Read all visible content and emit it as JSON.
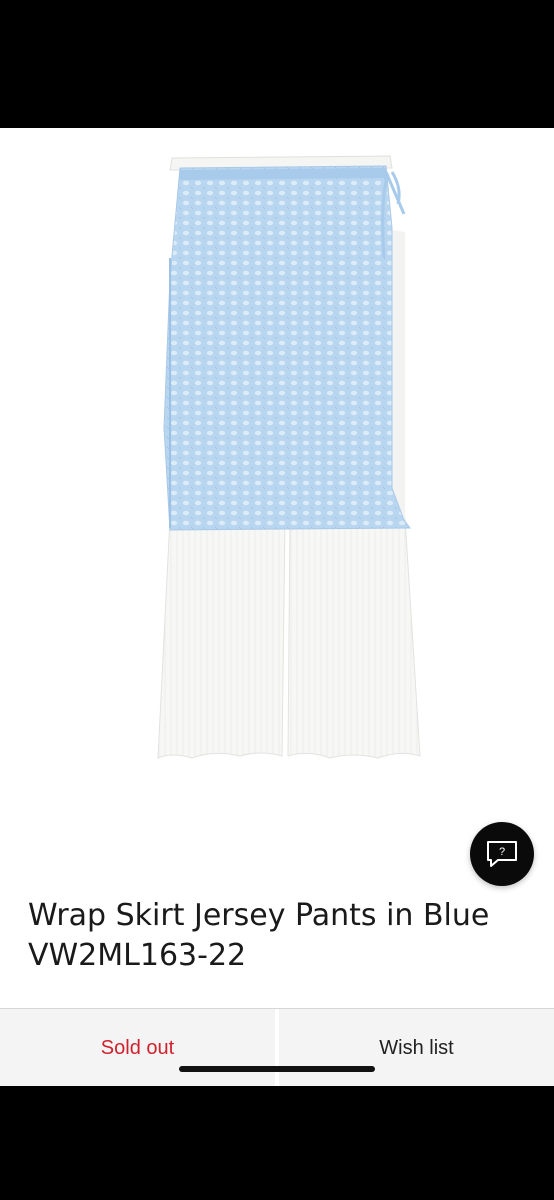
{
  "product": {
    "title": "Wrap Skirt Jersey Pants in Blue VW2ML163-22",
    "image_icon": "skirt-over-pants-product-photo",
    "colors": {
      "skirt": "#b9d6f0",
      "pants": "#f4f4f2"
    }
  },
  "chat": {
    "icon": "chat-question-icon",
    "glyph": "?"
  },
  "actions": {
    "sold_out_label": "Sold out",
    "wish_list_label": "Wish list",
    "sold_out_color": "#d0222c"
  }
}
